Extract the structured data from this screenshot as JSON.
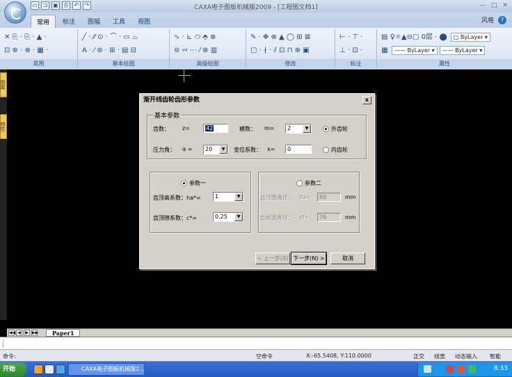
{
  "window": {
    "title": "CAXA电子图板机械版2009 - [工程图文档1]",
    "controls": [
      "—",
      "□",
      "✕"
    ]
  },
  "qat_icons": [
    "new-file-icon",
    "open-icon",
    "save-icon",
    "print-icon",
    "undo-icon",
    "redo-icon"
  ],
  "ribbon": {
    "tabs": [
      {
        "label": "常用",
        "active": true
      },
      {
        "label": "标注",
        "active": false
      },
      {
        "label": "图幅",
        "active": false
      },
      {
        "label": "工具",
        "active": false
      },
      {
        "label": "视图",
        "active": false
      }
    ],
    "style_label": "风格",
    "help": "?",
    "panels": [
      {
        "label": "常用",
        "row1": "✕ ⎘ · ⎘ · ▲ ·",
        "row2": "⊡ ⊕ · ⊗ · ▦ ·"
      },
      {
        "label": "基本绘图",
        "row1": "╱ · ⁄⁄ ⊙ · ⌒ · ▭ ⌓",
        "row2": "A · ⁄ ⊛ · ⊞ · ▤ ⊟"
      },
      {
        "label": "高级绘图",
        "row1": "∿ · ⊾ ⬭ ⬘ ⊗",
        "row2": "⊜ ∾ ⋯ ⁄ ⊗ ▥"
      },
      {
        "label": "修改",
        "row1": "✎ · ✥ ⊗ ▲ ◯ ⊞ ⊠",
        "row2": "▢ · ∤ · ⫽ ⊡ ⊓ ⊕ ▣"
      },
      {
        "label": "标注",
        "row1": "⊢ · ⊤ ·",
        "row2": "⊥ · ⊡ ·"
      },
      {
        "label": "属性",
        "row1": "▤ ♀☼▲⊖▢ 0层 · ⬤",
        "row2": "▦"
      }
    ],
    "layer_combos": [
      "ByLayer",
      "ByLayer",
      "ByLayer"
    ]
  },
  "side_tabs": [
    "图库",
    "特性"
  ],
  "dialog": {
    "title": "渐开线齿轮齿形参数",
    "close": "x",
    "basic_group": {
      "title": "基本参数",
      "teeth_label": "齿数：",
      "teeth_sym": "z=",
      "teeth_value": "42",
      "module_label": "模数：",
      "module_sym": "m=",
      "module_value": "2",
      "pressure_label": "压力角：",
      "pressure_sym": "α =",
      "pressure_value": "20",
      "shift_label": "变位系数：",
      "shift_sym": "x=",
      "shift_value": "0",
      "external_gear": "外齿轮",
      "internal_gear": "内齿轮"
    },
    "param1_group": {
      "title": "参数一",
      "addendum_label": "齿顶高系数：ha*=",
      "addendum_value": "1",
      "clearance_label": "齿顶隙系数：c*=",
      "clearance_value": "0.25"
    },
    "param2_group": {
      "title": "参数二",
      "tip_diam_label": "齿顶圆直径：",
      "tip_diam_sym": "da=",
      "tip_diam_value": "88",
      "root_diam_label": "齿根圆直径：",
      "root_diam_sym": "df=",
      "root_diam_value": "79",
      "unit": "mm"
    },
    "buttons": {
      "prev": "< 上一步(B)",
      "next": "下一步(N) >",
      "cancel": "取消"
    }
  },
  "layout_tab": "Paper1",
  "layout_nav": [
    "◀◀",
    "◀",
    "▶",
    "▶▶"
  ],
  "command": {
    "prompt": "命令:",
    "current": "空命令",
    "coords": "X:-65.5408, Y:110.0000",
    "modes": [
      "正交",
      "线宽",
      "动态输入",
      "智能"
    ]
  },
  "taskbar": {
    "start": "开始",
    "task": "CAXA电子图板机械版2...",
    "clock": "8:33"
  }
}
